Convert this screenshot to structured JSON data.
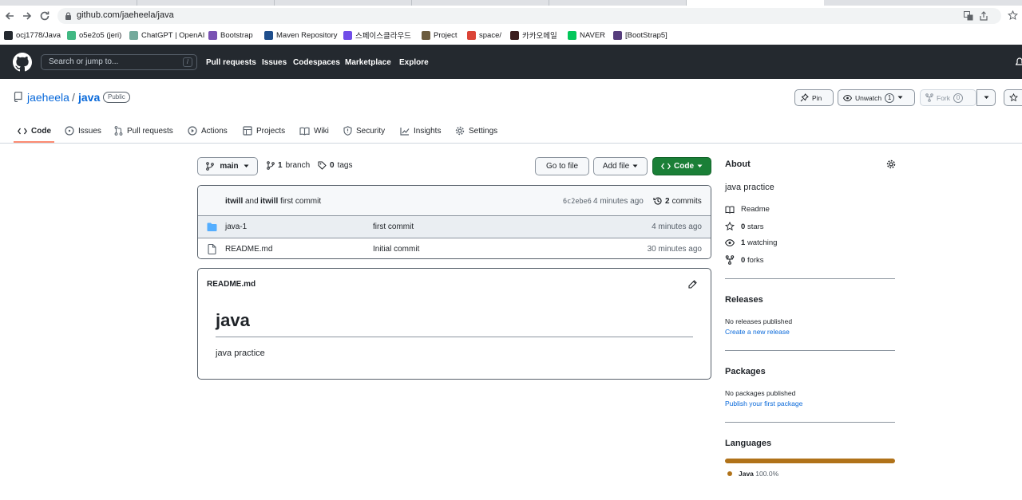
{
  "browser": {
    "url": "github.com/jaeheela/java",
    "bookmarks": [
      {
        "label": "ocj1778/Java",
        "icon": "github-icon",
        "color": "#24292f"
      },
      {
        "label": "o5e2o5 (jeri)",
        "icon": "vue-icon",
        "color": "#41b883"
      },
      {
        "label": "ChatGPT | OpenAI",
        "icon": "openai-icon",
        "color": "#74aa9c"
      },
      {
        "label": "Bootstrap",
        "icon": "bootstrap-icon",
        "color": "#7952b3"
      },
      {
        "label": "Maven Repository",
        "icon": "maven-icon",
        "color": "#1f4e8c"
      },
      {
        "label": "스페이스클라우드",
        "icon": "spacecloud-icon",
        "color": "#704de8"
      },
      {
        "label": "Project",
        "icon": "project-icon",
        "color": "#6b5b3e"
      },
      {
        "label": "space/",
        "icon": "chrome-icon",
        "color": "#db4437"
      },
      {
        "label": "카카오메일",
        "icon": "kakao-icon",
        "color": "#3c1e1e"
      },
      {
        "label": "NAVER",
        "icon": "naver-icon",
        "color": "#03c75a"
      },
      {
        "label": "[BootStrap5]",
        "icon": "bootstrap5-icon",
        "color": "#563d7c"
      }
    ]
  },
  "github": {
    "search_placeholder": "Search or jump to...",
    "search_shortcut": "/",
    "nav": [
      "Pull requests",
      "Issues",
      "Codespaces",
      "Marketplace",
      "Explore"
    ]
  },
  "repo": {
    "owner": "jaeheela",
    "separator": "/",
    "name": "java",
    "visibility": "Public",
    "pin_label": "Pin",
    "unwatch_label": "Unwatch",
    "watch_count": "1",
    "fork_label": "Fork",
    "fork_count": "0"
  },
  "tabs": [
    "Code",
    "Issues",
    "Pull requests",
    "Actions",
    "Projects",
    "Wiki",
    "Security",
    "Insights",
    "Settings"
  ],
  "branch_bar": {
    "branch": "main",
    "branches_count": "1",
    "branches_label": "branch",
    "tags_count": "0",
    "tags_label": "tags",
    "go_to_file": "Go to file",
    "add_file": "Add file",
    "code": "Code"
  },
  "latest_commit": {
    "author": "itwill",
    "conjunction": "and",
    "coauthor": "itwill",
    "message": "first commit",
    "sha": "6c2ebe6",
    "time": "4 minutes ago",
    "commits_count": "2",
    "commits_label": "commits"
  },
  "files": [
    {
      "name": "java-1",
      "type": "folder",
      "message": "first commit",
      "time": "4 minutes ago"
    },
    {
      "name": "README.md",
      "type": "file",
      "message": "Initial commit",
      "time": "30 minutes ago"
    }
  ],
  "readme": {
    "filename": "README.md",
    "heading": "java",
    "body": "java practice"
  },
  "sidebar": {
    "about_title": "About",
    "description": "java practice",
    "readme_label": "Readme",
    "stars_count": "0",
    "stars_label": "stars",
    "watching_count": "1",
    "watching_label": "watching",
    "forks_count": "0",
    "forks_label": "forks",
    "releases_title": "Releases",
    "releases_none": "No releases published",
    "releases_link": "Create a new release",
    "packages_title": "Packages",
    "packages_none": "No packages published",
    "packages_link": "Publish your first package",
    "languages_title": "Languages",
    "language_name": "Java",
    "language_percent": "100.0%",
    "language_color": "#b07219"
  },
  "colors": {
    "header_bg": "#24292f",
    "link": "#0969da",
    "code_button": "#1a7f37",
    "tab_underline": "#fd8c73"
  }
}
